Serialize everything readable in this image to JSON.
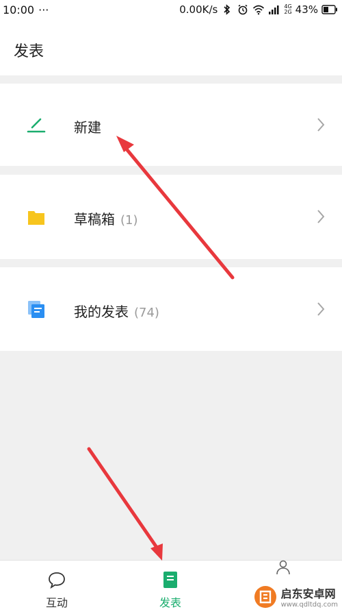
{
  "status_bar": {
    "time": "10:00",
    "more": "···",
    "speed": "0.00K/s",
    "network": "4G",
    "network2": "2G",
    "battery": "43%"
  },
  "header": {
    "title": "发表"
  },
  "menu": {
    "new": {
      "label": "新建",
      "icon": "pen-icon",
      "color": "#1aad6e"
    },
    "drafts": {
      "label": "草稿箱",
      "count": "(1)",
      "icon": "folder-icon",
      "color": "#f7c51e"
    },
    "my_posts": {
      "label": "我的发表",
      "count": "(74)",
      "icon": "documents-icon",
      "color": "#2b8ff2"
    }
  },
  "tabs": [
    {
      "label": "互动",
      "icon": "chat-bubble-icon",
      "active": false
    },
    {
      "label": "发表",
      "icon": "document-icon",
      "active": true,
      "color": "#1aad6e"
    },
    {
      "label": "",
      "icon": "person-icon",
      "active": false
    }
  ],
  "annotation": {
    "arrow_color": "#e8383d"
  },
  "watermark": {
    "title": "启东安卓网",
    "url": "www.qdltdq.com"
  }
}
